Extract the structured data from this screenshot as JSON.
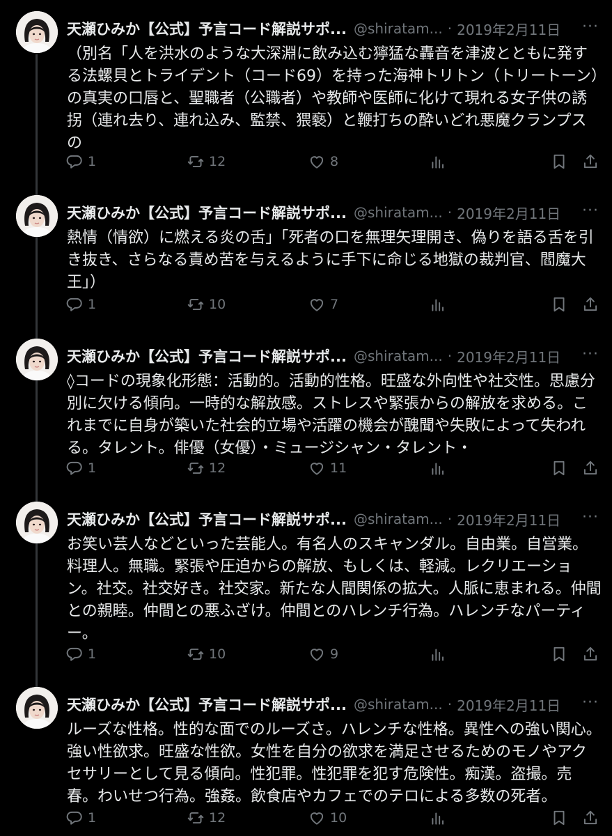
{
  "tweets": [
    {
      "name": "天瀬ひみか【公式】予言コード解説サポ...",
      "handle": "@shiratam...",
      "separator": "·",
      "date": "2019年2月11日",
      "more": "···",
      "text": "（別名「人を洪水のような大深淵に飲み込む獰猛な轟音を津波とともに発する法螺貝とトライデント（コード69）を持った海神トリトン（トリートーン）の真実の口唇と、聖職者（公職者）や教師や医師に化けて現れる女子供の誘拐（連れ去り、連れ込み、監禁、猥褻）と鞭打ちの酔いどれ悪魔クランプスの",
      "replies": "1",
      "retweets": "12",
      "likes": "8"
    },
    {
      "name": "天瀬ひみか【公式】予言コード解説サポ...",
      "handle": "@shiratam...",
      "separator": "·",
      "date": "2019年2月11日",
      "more": "···",
      "text": "熱情（情欲）に燃える炎の舌」「死者の口を無理矢理開き、偽りを語る舌を引き抜き、さらなる責め苦を与えるように手下に命じる地獄の裁判官、閻魔大王」）",
      "replies": "1",
      "retweets": "10",
      "likes": "7"
    },
    {
      "name": "天瀬ひみか【公式】予言コード解説サポ...",
      "handle": "@shiratam...",
      "separator": "·",
      "date": "2019年2月11日",
      "more": "···",
      "text": "◊コードの現象化形態：活動的。活動的性格。旺盛な外向性や社交性。思慮分別に欠ける傾向。一時的な解放感。ストレスや緊張からの解放を求める。これまでに自身が築いた社会的立場や活躍の機会が醜聞や失敗によって失われる。タレント。俳優（女優）・ミュージシャン・タレント・",
      "replies": "1",
      "retweets": "12",
      "likes": "11"
    },
    {
      "name": "天瀬ひみか【公式】予言コード解説サポ...",
      "handle": "@shiratam...",
      "separator": "·",
      "date": "2019年2月11日",
      "more": "···",
      "text": "お笑い芸人などといった芸能人。有名人のスキャンダル。自由業。自営業。料理人。無職。緊張や圧迫からの解放、もしくは、軽減。レクリエーション。社交。社交好き。社交家。新たな人間関係の拡大。人脈に恵まれる。仲間との親睦。仲間との悪ふざけ。仲間とのハレンチ行為。ハレンチなパーティー。",
      "replies": "1",
      "retweets": "10",
      "likes": "9"
    },
    {
      "name": "天瀬ひみか【公式】予言コード解説サポ...",
      "handle": "@shiratam...",
      "separator": "·",
      "date": "2019年2月11日",
      "more": "···",
      "text": "ルーズな性格。性的な面でのルーズさ。ハレンチな性格。異性への強い関心。強い性欲求。旺盛な性欲。女性を自分の欲求を満足させるためのモノやアクセサリーとして見る傾向。性犯罪。性犯罪を犯す危険性。痴漢。盗撮。売春。わいせつ行為。強姦。飲食店やカフェでのテロによる多数の死者。",
      "replies": "1",
      "retweets": "12",
      "likes": "10"
    }
  ],
  "colors": {
    "background": "#000000",
    "text": "#e7e9ea",
    "muted": "#71767b",
    "thread_line": "#333639"
  },
  "icons": [
    "reply-icon",
    "retweet-icon",
    "like-icon",
    "views-icon",
    "bookmark-icon",
    "share-icon"
  ]
}
